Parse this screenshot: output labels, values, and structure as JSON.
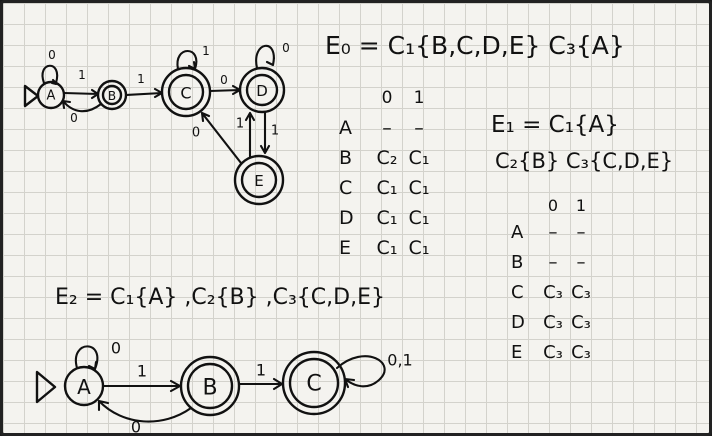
{
  "automaton1": {
    "states": [
      "A",
      "B",
      "C",
      "D",
      "E"
    ],
    "labels": {
      "a_self": "0",
      "a_b": "1",
      "b_a": "0",
      "b_c": "1",
      "c_self": "1",
      "c_d": "0",
      "d_self": "0",
      "d_e": "1",
      "e_d": "1",
      "e_c": "0"
    }
  },
  "partitions": {
    "e0": "E₀ = C₁{B,C,D,E} C₃{A}",
    "e1_line1": "E₁ = C₁{A}",
    "e1_line2": "C₂{B} C₃{C,D,E}",
    "e2": "E₂ = C₁{A} ,C₂{B} ,C₃{C,D,E}"
  },
  "table1": {
    "header": [
      "0",
      "1"
    ],
    "rows": [
      {
        "state": "A",
        "c0": "–",
        "c1": "–"
      },
      {
        "state": "B",
        "c0": "C₂",
        "c1": "C₁"
      },
      {
        "state": "C",
        "c0": "C₁",
        "c1": "C₁"
      },
      {
        "state": "D",
        "c0": "C₁",
        "c1": "C₁"
      },
      {
        "state": "E",
        "c0": "C₁",
        "c1": "C₁"
      }
    ]
  },
  "table2": {
    "header": [
      "0",
      "1"
    ],
    "rows": [
      {
        "state": "A",
        "c0": "–",
        "c1": "–"
      },
      {
        "state": "B",
        "c0": "–",
        "c1": "–"
      },
      {
        "state": "C",
        "c0": "C₃",
        "c1": "C₃"
      },
      {
        "state": "D",
        "c0": "C₃",
        "c1": "C₃"
      },
      {
        "state": "E",
        "c0": "C₃",
        "c1": "C₃"
      }
    ]
  },
  "automaton2": {
    "states": [
      "A",
      "B",
      "C"
    ],
    "labels": {
      "a_self": "0",
      "a_b": "1",
      "b_a": "0",
      "b_c": "1",
      "c_self": "0,1"
    }
  }
}
